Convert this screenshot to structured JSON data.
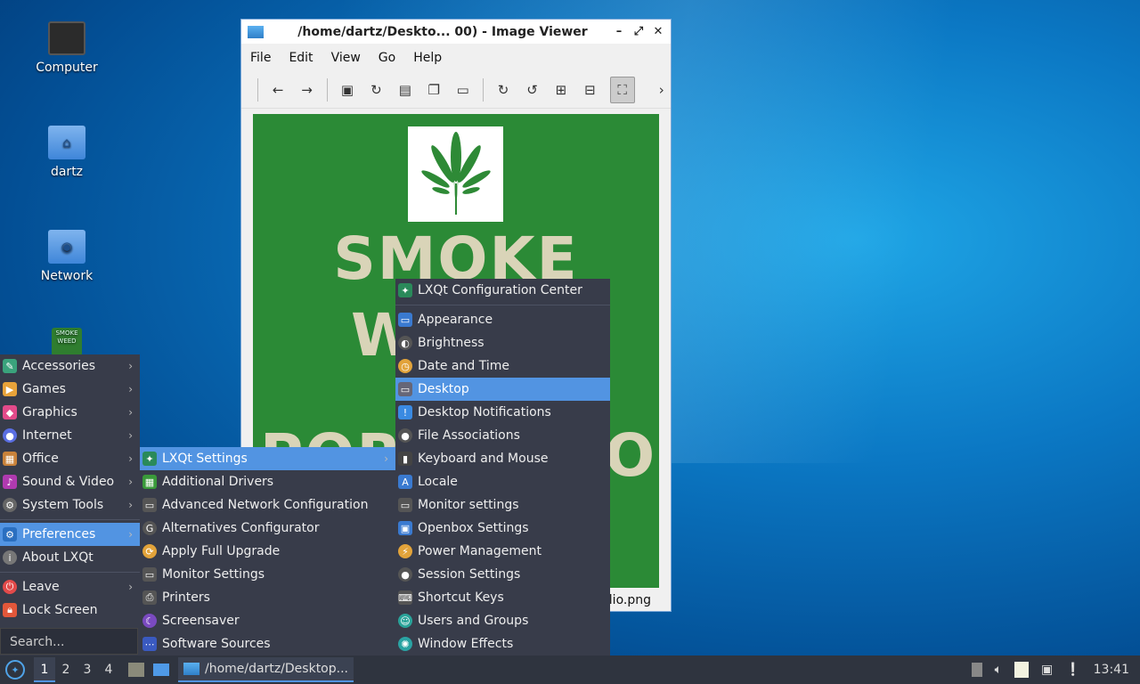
{
  "desktop": {
    "icons": [
      {
        "label": "Computer"
      },
      {
        "label": "dartz"
      },
      {
        "label": "Network"
      }
    ],
    "poster_icon_text": "SMOKE WEED"
  },
  "viewer": {
    "title": "/home/dartz/Deskto... 00) - Image Viewer",
    "menu": [
      "File",
      "Edit",
      "View",
      "Go",
      "Help"
    ],
    "poster_lines": [
      "SMOKE",
      "W",
      "POR",
      "O"
    ],
    "status": "lio.png"
  },
  "main_menu": {
    "items": [
      "Accessories",
      "Games",
      "Graphics",
      "Internet",
      "Office",
      "Sound & Video",
      "System Tools",
      "Preferences",
      "About LXQt",
      "Leave",
      "Lock Screen"
    ],
    "search_placeholder": "Search..."
  },
  "preferences_menu": {
    "items": [
      "LXQt Settings",
      "Additional Drivers",
      "Advanced Network Configuration",
      "Alternatives Configurator",
      "Apply Full Upgrade",
      "Monitor Settings",
      "Printers",
      "Screensaver",
      "Software Sources"
    ]
  },
  "lxqt_settings_menu": {
    "items": [
      "LXQt Configuration Center",
      "Appearance",
      "Brightness",
      "Date and Time",
      "Desktop",
      "Desktop Notifications",
      "File Associations",
      "Keyboard and Mouse",
      "Locale",
      "Monitor settings",
      "Openbox Settings",
      "Power Management",
      "Session Settings",
      "Shortcut Keys",
      "Users and Groups",
      "Window Effects"
    ]
  },
  "taskbar": {
    "desktops": [
      "1",
      "2",
      "3",
      "4"
    ],
    "task_title": "/home/dartz/Desktop...",
    "clock": "13:41"
  },
  "colors": {
    "highlight": "#5294e2",
    "menu_bg": "#383c4a",
    "panel_bg": "#2f343f",
    "poster_green": "#2b8a36"
  }
}
